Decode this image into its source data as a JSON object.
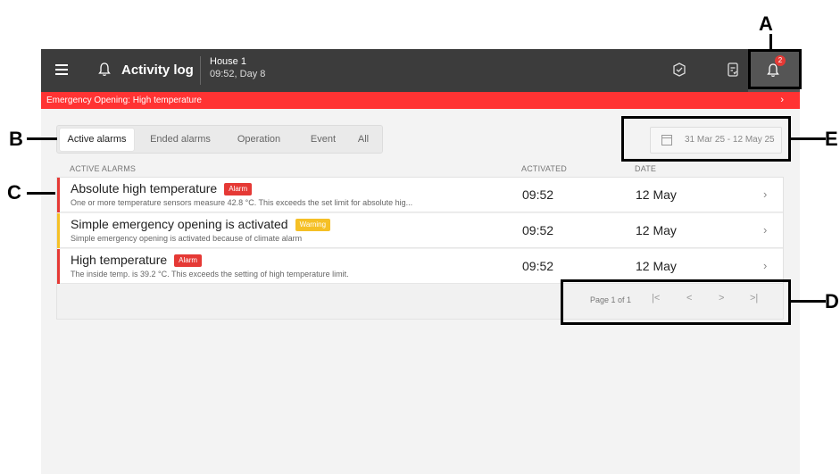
{
  "topbar": {
    "title": "Activity log",
    "house_name": "House 1",
    "house_time": "09:52, Day 8",
    "notification_count": "2"
  },
  "banner": {
    "text": "Emergency Opening: High temperature"
  },
  "tabs": [
    {
      "label": "Active alarms",
      "active": true
    },
    {
      "label": "Ended alarms",
      "active": false
    },
    {
      "label": "Operation",
      "active": false
    },
    {
      "label": "Event",
      "active": false
    },
    {
      "label": "All",
      "active": false
    }
  ],
  "date_range": "31 Mar 25 - 12 May 25",
  "columns": {
    "active_alarms": "ACTIVE ALARMS",
    "activated": "ACTIVATED",
    "date": "DATE"
  },
  "rows": [
    {
      "title": "Absolute high temperature",
      "badge": "Alarm",
      "description": "One or more temperature sensors measure 42.8 °C. This exceeds the set limit for absolute hig...",
      "activated": "09:52",
      "date": "12 May"
    },
    {
      "title": "Simple emergency opening is activated",
      "badge": "Warning",
      "description": "Simple emergency opening is activated because of climate alarm",
      "activated": "09:52",
      "date": "12 May"
    },
    {
      "title": "High temperature",
      "badge": "Alarm",
      "description": "The inside temp. is 39.2 °C. This exceeds the setting of high temperature limit.",
      "activated": "09:52",
      "date": "12 May"
    }
  ],
  "pager": {
    "label": "Page 1 of 1",
    "first": "|<",
    "prev": "<",
    "next": ">",
    "last": ">|"
  },
  "annotations": {
    "a": "A",
    "b": "B",
    "c": "C",
    "d": "D",
    "e": "E"
  },
  "colors": {
    "topbar": "#3c3c3c",
    "banner": "#ff3333",
    "alarm": "#e53935",
    "warning": "#f5c026"
  }
}
